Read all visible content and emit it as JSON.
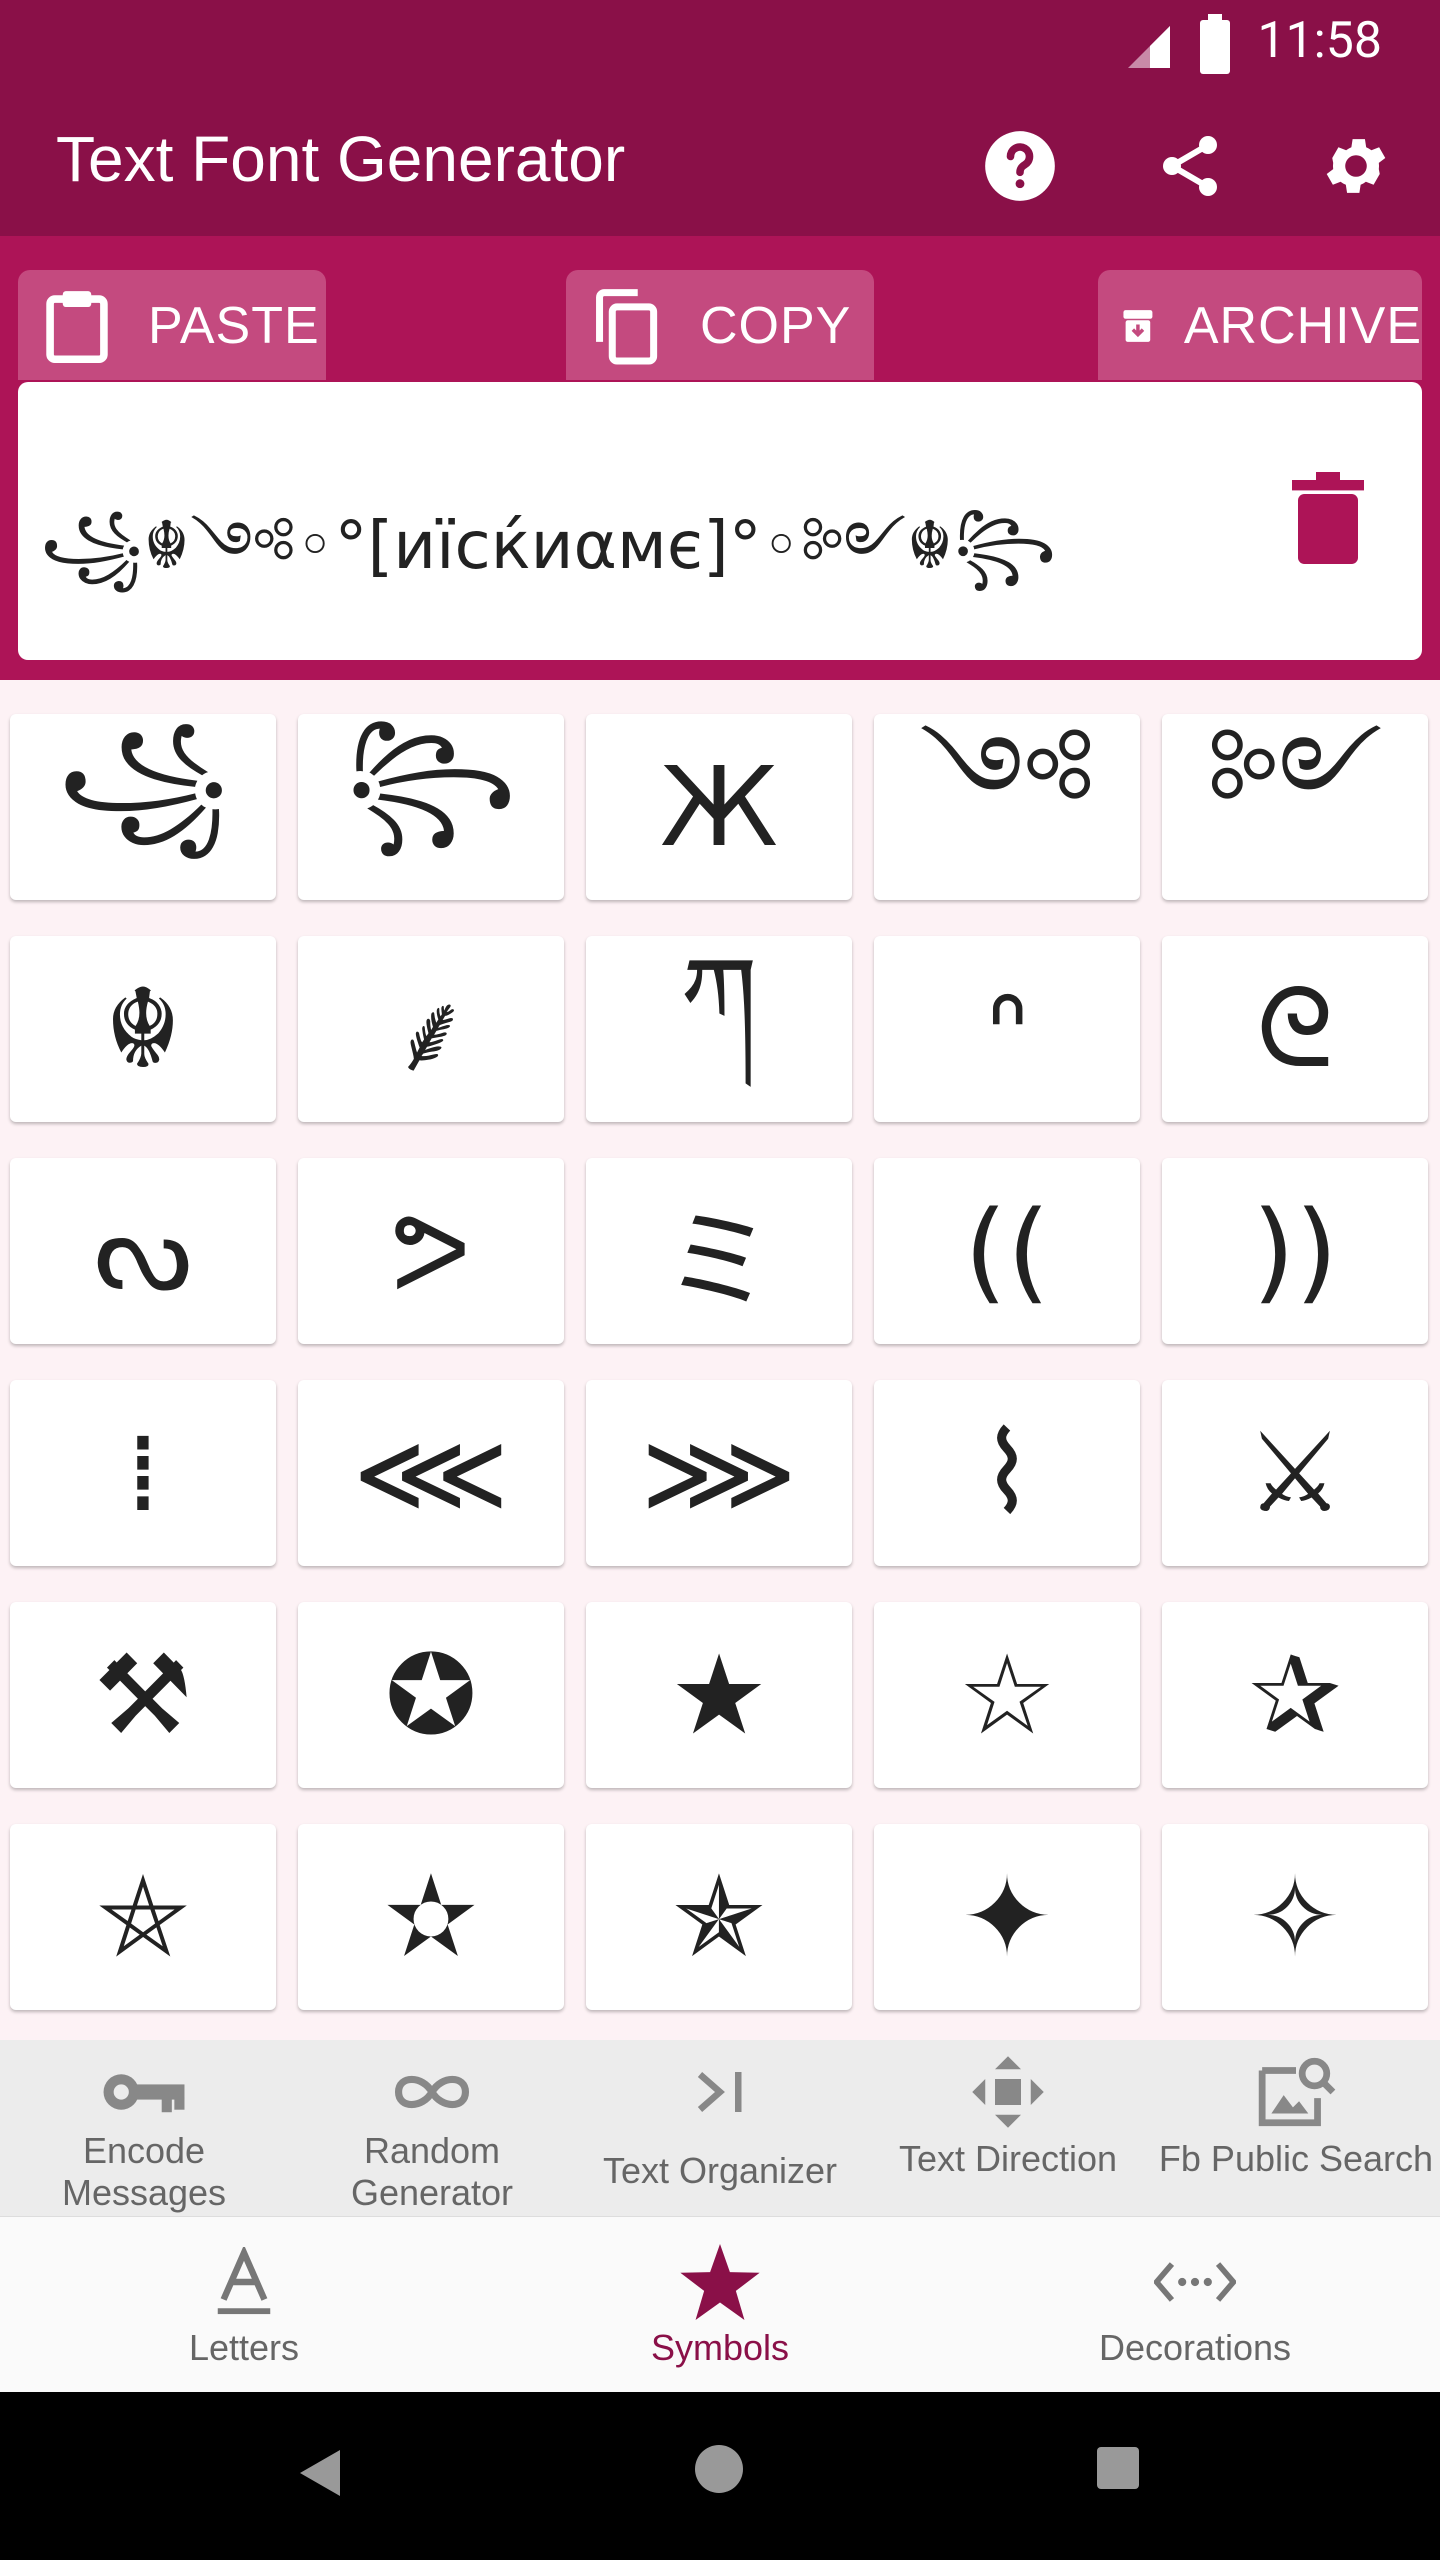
{
  "status": {
    "time": "11:58"
  },
  "app": {
    "title": "Text Font Generator"
  },
  "toolbar": {
    "paste": "PASTE",
    "copy": "COPY",
    "archive": "ARCHIVE"
  },
  "preview": {
    "text": "꧁☬༺◦°[иїсќиαмє]°◦༻☬꧂"
  },
  "symbols": [
    "꧁",
    "꧂",
    "Ж",
    "༺",
    "༻",
    "☬",
    "⸙",
    "ཀ",
    "ᐢ",
    "ᘓ",
    "ᔓ",
    "ᕗ",
    "ミ",
    "((",
    "))",
    "⁞",
    "⋘",
    "⋙",
    "⌇",
    "⚔",
    "⚒",
    "✪",
    "★",
    "☆",
    "✰",
    "⛤",
    "✫",
    "✯",
    "✦",
    "✧"
  ],
  "tools": [
    {
      "label": "Encode Messages",
      "icon": "key-icon"
    },
    {
      "label": "Random Generator",
      "icon": "infinity-icon"
    },
    {
      "label": "Text Organizer",
      "icon": "chevron-bar-icon"
    },
    {
      "label": "Text Direction",
      "icon": "arrows-move-icon"
    },
    {
      "label": "Fb Public Search",
      "icon": "image-search-icon"
    }
  ],
  "nav": [
    {
      "label": "Letters",
      "icon": "letter-a-icon"
    },
    {
      "label": "Symbols",
      "icon": "star-icon"
    },
    {
      "label": "Decorations",
      "icon": "code-dots-icon"
    }
  ],
  "colors": {
    "primary": "#8a1048",
    "secondary": "#ad1457",
    "background": "#fdf2f5"
  }
}
